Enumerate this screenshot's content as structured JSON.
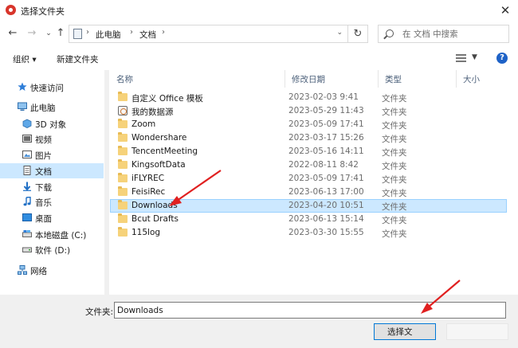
{
  "window": {
    "title": "选择文件夹",
    "close_glyph": "✕",
    "accent_color": "#0078d7",
    "selection_color": "#cce8ff"
  },
  "address": {
    "breadcrumbs": [
      "此电脑",
      "文档"
    ],
    "search_placeholder": "在 文档 中搜索"
  },
  "toolbar": {
    "organize_label": "组织 ▾",
    "new_folder_label": "新建文件夹",
    "help_glyph": "?"
  },
  "navpane": {
    "items": [
      {
        "label": "快速访问",
        "icon": "star-icon"
      },
      {
        "label": "此电脑",
        "icon": "computer-icon"
      },
      {
        "label": "3D 对象",
        "icon": "cube-icon"
      },
      {
        "label": "视频",
        "icon": "video-icon"
      },
      {
        "label": "图片",
        "icon": "picture-icon"
      },
      {
        "label": "文档",
        "icon": "document-icon"
      },
      {
        "label": "下载",
        "icon": "download-icon"
      },
      {
        "label": "音乐",
        "icon": "music-icon"
      },
      {
        "label": "桌面",
        "icon": "desktop-icon"
      },
      {
        "label": "本地磁盘 (C:)",
        "icon": "drive-icon"
      },
      {
        "label": "软件 (D:)",
        "icon": "drive-icon"
      },
      {
        "label": "网络",
        "icon": "network-icon"
      }
    ]
  },
  "filelist": {
    "columns": [
      "名称",
      "修改日期",
      "类型",
      "大小"
    ],
    "rows": [
      {
        "name": "自定义 Office 模板",
        "date": "2023-02-03 9:41",
        "type": "文件夹",
        "icon": "folder-icon"
      },
      {
        "name": "我的数据源",
        "date": "2023-05-29 11:43",
        "type": "文件夹",
        "icon": "database-icon"
      },
      {
        "name": "Zoom",
        "date": "2023-05-09 17:41",
        "type": "文件夹",
        "icon": "folder-icon"
      },
      {
        "name": "Wondershare",
        "date": "2023-03-17 15:26",
        "type": "文件夹",
        "icon": "folder-icon"
      },
      {
        "name": "TencentMeeting",
        "date": "2023-05-16 14:11",
        "type": "文件夹",
        "icon": "folder-icon"
      },
      {
        "name": "KingsoftData",
        "date": "2022-08-11 8:42",
        "type": "文件夹",
        "icon": "folder-icon"
      },
      {
        "name": "iFLYREC",
        "date": "2023-05-09 17:41",
        "type": "文件夹",
        "icon": "folder-icon"
      },
      {
        "name": "FeisiRec",
        "date": "2023-06-13 17:00",
        "type": "文件夹",
        "icon": "folder-icon"
      },
      {
        "name": "Downloads",
        "date": "2023-04-20 10:51",
        "type": "文件夹",
        "icon": "folder-icon"
      },
      {
        "name": "Bcut Drafts",
        "date": "2023-06-13 15:14",
        "type": "文件夹",
        "icon": "folder-icon"
      },
      {
        "name": "115log",
        "date": "2023-03-30 15:55",
        "type": "文件夹",
        "icon": "folder-icon"
      }
    ]
  },
  "bottom": {
    "folder_label": "文件夹:",
    "folder_value": "Downloads",
    "select_button": "选择文"
  }
}
